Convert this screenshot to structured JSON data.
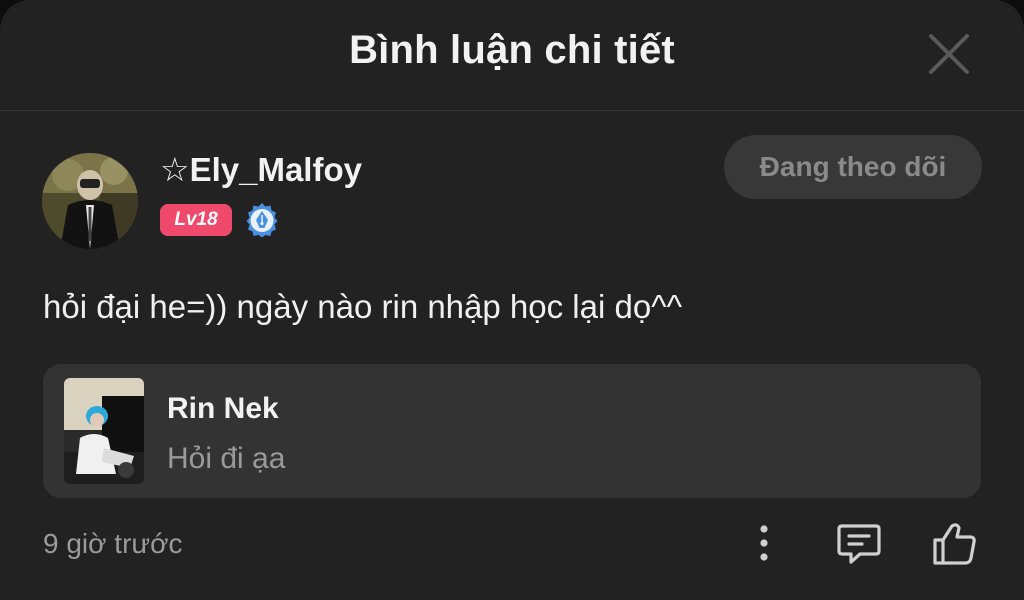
{
  "header": {
    "title": "Bình luận chi tiết",
    "close_icon": "close-icon"
  },
  "comment": {
    "author": {
      "name": "☆Ely_Malfoy",
      "level": "Lv18",
      "verified_icon": "pen-nib-badge-icon"
    },
    "follow_label": "Đang theo dõi",
    "text": "hỏi đại he=)) ngày nào rin nhập học lại dọ^^",
    "quoted": {
      "author": "Rin Nek",
      "text": "Hỏi đi ạa"
    },
    "timestamp": "9 giờ trước"
  },
  "actions": {
    "more_icon": "more-vertical-icon",
    "reply_icon": "reply-comment-icon",
    "like_icon": "thumbs-up-icon"
  },
  "colors": {
    "background": "#222222",
    "level_badge": "#ef4a6b",
    "verified": "#4a8fe0",
    "follow_button": "#383838"
  }
}
